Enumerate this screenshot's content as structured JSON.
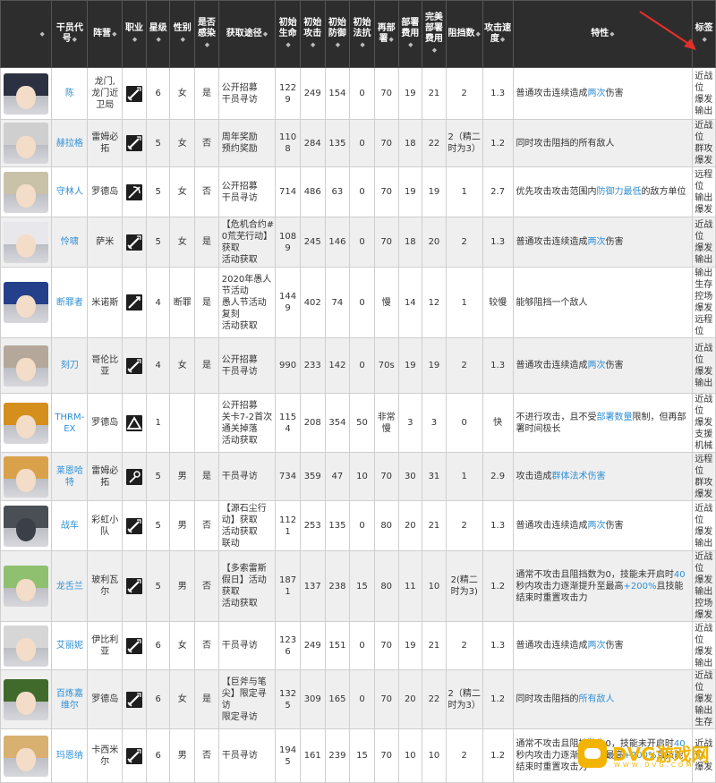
{
  "headers": [
    "干员代号",
    "阵营",
    "职业",
    "星级",
    "性别",
    "是否感染",
    "获取途径",
    "初始生命",
    "初始攻击",
    "初始防御",
    "初始法抗",
    "再部署",
    "部署费用",
    "完美部署费用",
    "阻挡数",
    "攻击速度",
    "特性",
    "标签"
  ],
  "sort_marker": "◆",
  "rows": [
    {
      "avatar_icon": "chen-portrait-icon",
      "hair": "#2b3140",
      "name": "陈",
      "camp": "龙门, 龙门近卫局",
      "class_icon": "guard-sword-icon",
      "star": "6",
      "gender": "女",
      "infected": "是",
      "obtain": "公开招募\n干员寻访",
      "hp": "1229",
      "atk": "249",
      "def": "154",
      "res": "0",
      "redeploy": "70",
      "cost": "19",
      "perfect_cost": "21",
      "block": "2",
      "speed": "1.3",
      "feat": [
        {
          "t": "普通攻击连续造成"
        },
        {
          "t": "两次",
          "hl": true
        },
        {
          "t": "伤害"
        }
      ],
      "tags": "近战位\n爆发\n输出"
    },
    {
      "avatar_icon": "shining-portrait-icon",
      "hair": "#cfcfcf",
      "name": "赫拉格",
      "camp": "雷姆必拓",
      "class_icon": "guard-sword-icon",
      "star": "5",
      "gender": "女",
      "infected": "否",
      "obtain": "周年奖励\n预约奖励",
      "hp": "1108",
      "atk": "284",
      "def": "135",
      "res": "0",
      "redeploy": "70",
      "cost": "18",
      "perfect_cost": "22",
      "block": "2（精二时为3）",
      "speed": "1.2",
      "feat": [
        {
          "t": "同时攻击阻挡的所有敌人"
        }
      ],
      "tags": "近战位\n群攻\n爆发"
    },
    {
      "avatar_icon": "shiraiyuki-portrait-icon",
      "hair": "#c9c1a8",
      "name": "守林人",
      "camp": "罗德岛",
      "class_icon": "sniper-crossbow-icon",
      "star": "5",
      "gender": "女",
      "infected": "否",
      "obtain": "公开招募\n干员寻访",
      "hp": "714",
      "atk": "486",
      "def": "63",
      "res": "0",
      "redeploy": "70",
      "cost": "19",
      "perfect_cost": "19",
      "block": "1",
      "speed": "2.7",
      "feat": [
        {
          "t": "优先攻击攻击范围内"
        },
        {
          "t": "防御力最低",
          "hl": true
        },
        {
          "t": "的敌方单位"
        }
      ],
      "tags": "远程位\n输出\n爆发"
    },
    {
      "avatar_icon": "whislash-portrait-icon",
      "hair": "#e8e8ec",
      "name": "怜啸",
      "camp": "萨米",
      "class_icon": "guard-sword-icon",
      "star": "5",
      "gender": "女",
      "infected": "是",
      "obtain": "【危机合约#0荒芜行动】获取\n活动获取",
      "hp": "1089",
      "atk": "245",
      "def": "146",
      "res": "0",
      "redeploy": "70",
      "cost": "18",
      "perfect_cost": "20",
      "block": "2",
      "speed": "1.3",
      "feat": [
        {
          "t": "普通攻击连续造成"
        },
        {
          "t": "两次",
          "hl": true
        },
        {
          "t": "伤害"
        }
      ],
      "tags": "近战位\n爆发\n输出"
    },
    {
      "avatar_icon": "specter-portrait-icon",
      "hair": "#25408a",
      "name": "断罪者",
      "camp": "米诺斯",
      "class_icon": "specialist-icon",
      "star": "4",
      "gender": "断罪",
      "infected": "是",
      "obtain": "2020年愚人节活动\n愚人节活动复刻\n活动获取",
      "hp": "1449",
      "atk": "402",
      "def": "74",
      "res": "0",
      "redeploy": "慢",
      "cost": "14",
      "perfect_cost": "12",
      "block": "1",
      "speed": "较慢",
      "feat": [
        {
          "t": "能够阻挡一个敌人"
        }
      ],
      "tags": "输出\n生存\n控场\n爆发\n远程位"
    },
    {
      "avatar_icon": "cutter-portrait-icon",
      "hair": "#b5a89a",
      "name": "刻刀",
      "camp": "哥伦比亚",
      "class_icon": "guard-sword-icon",
      "star": "4",
      "gender": "女",
      "infected": "是",
      "obtain": "公开招募\n干员寻访",
      "hp": "990",
      "atk": "233",
      "def": "142",
      "res": "0",
      "redeploy": "70s",
      "cost": "19",
      "perfect_cost": "19",
      "block": "2",
      "speed": "1.3",
      "feat": [
        {
          "t": "普通攻击连续造成"
        },
        {
          "t": "两次",
          "hl": true
        },
        {
          "t": "伤害"
        }
      ],
      "tags": "近战位\n爆发\n输出"
    },
    {
      "avatar_icon": "thrm-ex-portrait-icon",
      "hair": "#d48f1c",
      "name": "THRM-EX",
      "camp": "罗德岛",
      "class_icon": "specialist-triangle-icon",
      "star": "1",
      "gender": "",
      "infected": "",
      "obtain": "公开招募\n关卡7-2首次通关掉落\n活动获取",
      "hp": "1154",
      "atk": "208",
      "def": "354",
      "res": "50",
      "redeploy": "非常慢",
      "cost": "3",
      "perfect_cost": "3",
      "block": "0",
      "speed": "快",
      "feat": [
        {
          "t": "不进行攻击，且不受"
        },
        {
          "t": "部署数量",
          "hl": true
        },
        {
          "t": "限制，但再部署时间极长"
        }
      ],
      "tags": "近战位\n爆发\n支援\n机械"
    },
    {
      "avatar_icon": "ceobe-portrait-icon",
      "hair": "#d9a24a",
      "name": "莱恩哈特",
      "camp": "雷姆必拓",
      "class_icon": "caster-staff-icon",
      "star": "5",
      "gender": "男",
      "infected": "是",
      "obtain": "干员寻访",
      "hp": "734",
      "atk": "359",
      "def": "47",
      "res": "10",
      "redeploy": "70",
      "cost": "30",
      "perfect_cost": "31",
      "block": "1",
      "speed": "2.9",
      "feat": [
        {
          "t": "攻击造成"
        },
        {
          "t": "群体法术伤害",
          "hl": true
        }
      ],
      "tags": "远程位\n群攻\n爆发"
    },
    {
      "avatar_icon": "tachanka-portrait-icon",
      "hair": "#4a4e55",
      "mask": true,
      "name": "战车",
      "camp": "彩虹小队",
      "class_icon": "guard-sword-icon",
      "star": "5",
      "gender": "男",
      "infected": "否",
      "obtain": "【源石尘行动】获取\n活动获取\n联动",
      "hp": "1121",
      "atk": "253",
      "def": "135",
      "res": "0",
      "redeploy": "80",
      "cost": "20",
      "perfect_cost": "21",
      "block": "2",
      "speed": "1.3",
      "feat": [
        {
          "t": "普通攻击连续造成"
        },
        {
          "t": "两次",
          "hl": true
        },
        {
          "t": "伤害"
        }
      ],
      "tags": "近战位\n爆发\n输出"
    },
    {
      "avatar_icon": "tulip-portrait-icon",
      "hair": "#8fc070",
      "name": "龙舌兰",
      "camp": "玻利瓦尔",
      "class_icon": "guard-sword-icon",
      "star": "5",
      "gender": "男",
      "infected": "否",
      "obtain": "【多索雷斯假日】活动获取\n活动获取",
      "hp": "1871",
      "atk": "137",
      "def": "238",
      "res": "15",
      "redeploy": "80",
      "cost": "11",
      "perfect_cost": "10",
      "block": "2(精二时为3)",
      "speed": "1.2",
      "feat": [
        {
          "t": "通常不攻击且阻挡数为0，技能未开启时"
        },
        {
          "t": "40",
          "hl": true
        },
        {
          "t": "秒内攻击力逐渐提升至最高"
        },
        {
          "t": "+200%",
          "hl": true
        },
        {
          "t": "且技能结束时重置攻击力"
        }
      ],
      "tags": "近战位\n爆发\n输出\n控场\n爆发"
    },
    {
      "avatar_icon": "irene-portrait-icon",
      "hair": "#d6d6d6",
      "name": "艾丽妮",
      "camp": "伊比利亚",
      "class_icon": "guard-sword-icon",
      "star": "6",
      "gender": "女",
      "infected": "否",
      "obtain": "干员寻访",
      "hp": "1236",
      "atk": "249",
      "def": "151",
      "res": "0",
      "redeploy": "70",
      "cost": "19",
      "perfect_cost": "21",
      "block": "2",
      "speed": "1.3",
      "feat": [
        {
          "t": "普通攻击连续造成"
        },
        {
          "t": "两次",
          "hl": true
        },
        {
          "t": "伤害"
        }
      ],
      "tags": "近战位\n爆发\n输出"
    },
    {
      "avatar_icon": "flint-portrait-icon",
      "hair": "#3f6a2c",
      "name": "百炼嘉维尔",
      "camp": "罗德岛",
      "class_icon": "guard-sword-icon",
      "star": "6",
      "gender": "女",
      "infected": "是",
      "obtain": "【巨斧与笔尖】限定寻访\n限定寻访",
      "hp": "1325",
      "atk": "309",
      "def": "165",
      "res": "0",
      "redeploy": "70",
      "cost": "20",
      "perfect_cost": "22",
      "block": "2（精二时为3）",
      "speed": "1.2",
      "feat": [
        {
          "t": "同时攻击阻挡的"
        },
        {
          "t": "所有敌人",
          "hl": true
        }
      ],
      "tags": "近战位\n爆发\n输出\n生存"
    },
    {
      "avatar_icon": "blemishine-portrait-icon",
      "hair": "#d8b070",
      "name": "玛恩纳",
      "camp": "卡西米尔",
      "class_icon": "guard-sword-icon",
      "star": "6",
      "gender": "男",
      "infected": "否",
      "obtain": "干员寻访",
      "hp": "1945",
      "atk": "161",
      "def": "239",
      "res": "15",
      "redeploy": "70",
      "cost": "10",
      "perfect_cost": "10",
      "block": "2",
      "speed": "1.2",
      "feat": [
        {
          "t": "通常不攻击且阻挡数为0，技能未开启时"
        },
        {
          "t": "40",
          "hl": true
        },
        {
          "t": "秒内攻击力逐渐提升至最高"
        },
        {
          "t": "+200%",
          "hl": true
        },
        {
          "t": "且技能结束时重置攻击力"
        }
      ],
      "tags": "近战位\n爆发"
    }
  ],
  "watermark": {
    "main": "DVG游戏网",
    "sub": "WWW.DVG.COM"
  },
  "colors": {
    "header_bg": "#2d2d2d",
    "link": "#2f8fd5",
    "row_alt": "#efefef",
    "annotation_arrow": "#e0302a",
    "watermark": "#f2b400"
  }
}
